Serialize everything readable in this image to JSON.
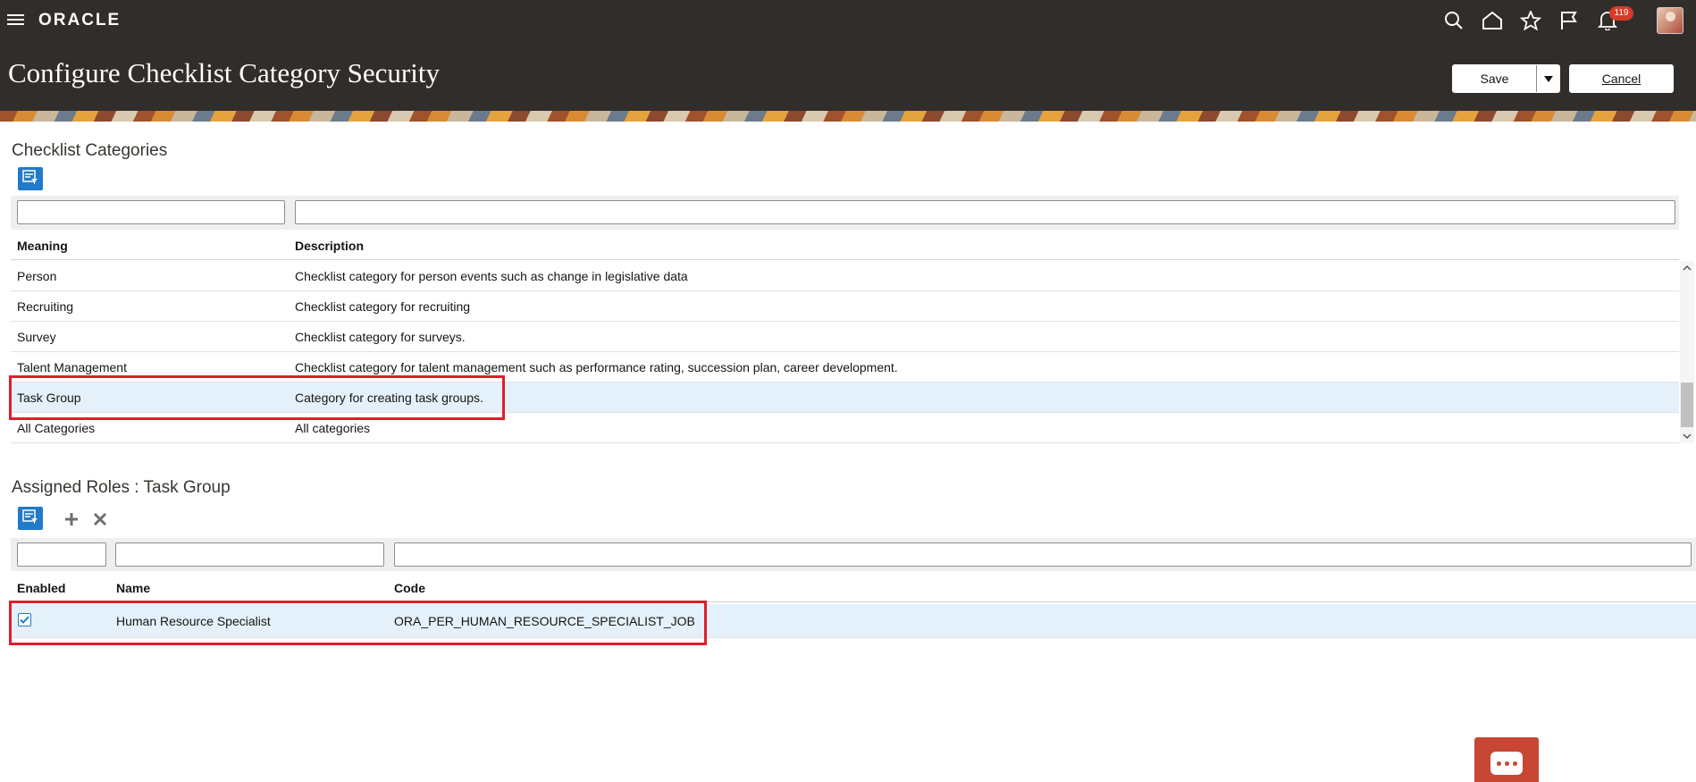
{
  "header": {
    "brand": "ORACLE",
    "notifications_count": "119",
    "page_title": "Configure Checklist Category Security",
    "save_label": "Save",
    "cancel_label": "Cancel"
  },
  "categories": {
    "title": "Checklist Categories",
    "columns": {
      "meaning": "Meaning",
      "description": "Description"
    },
    "rows": [
      {
        "meaning": "Person",
        "description": "Checklist category for person events such as change in legislative data"
      },
      {
        "meaning": "Recruiting",
        "description": "Checklist category for recruiting"
      },
      {
        "meaning": "Survey",
        "description": "Checklist category for surveys."
      },
      {
        "meaning": "Talent Management",
        "description": "Checklist category for talent management such as performance rating, succession plan, career development."
      },
      {
        "meaning": "Task Group",
        "description": "Category for creating task groups.",
        "selected": true
      },
      {
        "meaning": "All Categories",
        "description": "All categories"
      }
    ]
  },
  "roles": {
    "title": "Assigned Roles : Task Group",
    "columns": {
      "enabled": "Enabled",
      "name": "Name",
      "code": "Code"
    },
    "rows": [
      {
        "enabled": true,
        "name": "Human Resource Specialist",
        "code": "ORA_PER_HUMAN_RESOURCE_SPECIALIST_JOB"
      }
    ]
  },
  "colors": {
    "header_bg": "#312d2a",
    "accent_blue": "#227ac8",
    "selected_row": "#e5f1fa",
    "highlight_red": "#e11d2b",
    "chat_red": "#c74634"
  },
  "icons": [
    "menu-icon",
    "search-icon",
    "home-icon",
    "star-icon",
    "flag-icon",
    "bell-icon",
    "query-by-example-icon",
    "add-icon",
    "delete-icon",
    "chevron-up-icon",
    "chevron-down-icon",
    "checkmark-icon",
    "chat-icon"
  ]
}
